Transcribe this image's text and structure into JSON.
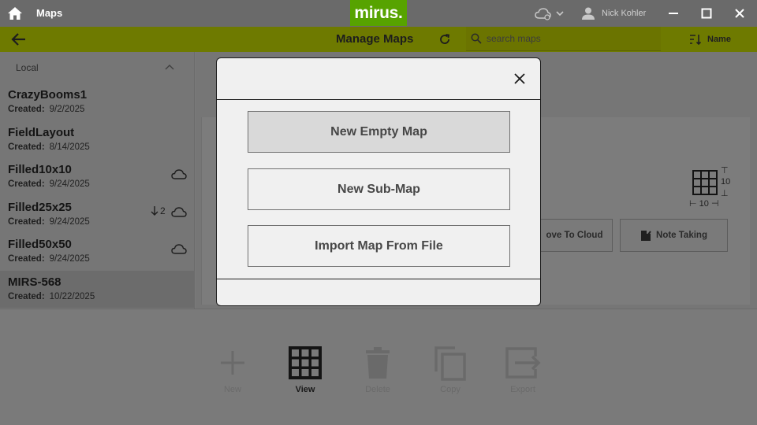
{
  "app": {
    "title": "Maps",
    "logo": "mirus.",
    "user": "Nick Kohler"
  },
  "toolbar": {
    "title": "Manage Maps",
    "search_placeholder": "search maps",
    "sort_label": "Name"
  },
  "sidebar": {
    "section_label": "Local",
    "created_label": "Created:",
    "maps": [
      {
        "name": "CrazyBooms1",
        "date": "9/2/2025"
      },
      {
        "name": "FieldLayout",
        "date": "8/14/2025"
      },
      {
        "name": "Filled10x10",
        "date": "9/24/2025"
      },
      {
        "name": "Filled25x25",
        "date": "9/24/2025",
        "pending": "2"
      },
      {
        "name": "Filled50x50",
        "date": "9/24/2025"
      },
      {
        "name": "MIRS-568",
        "date": "10/22/2025"
      }
    ]
  },
  "detail": {
    "grid_rows": "10",
    "grid_cols": "10",
    "move_to_cloud_label": "ove To Cloud",
    "note_taking_label": "Note Taking"
  },
  "bottom_bar": {
    "new_label": "New",
    "view_label": "View",
    "delete_label": "Delete",
    "copy_label": "Copy",
    "export_label": "Export"
  },
  "modal": {
    "options": [
      "New Empty Map",
      "New Sub-Map",
      "Import Map From File"
    ]
  },
  "colors": {
    "brand_green": "#57a300",
    "toolbar_olive": "#6e7a00",
    "modal_bg": "#f0f0f0",
    "overlay_gray": "#7a7a7a"
  }
}
